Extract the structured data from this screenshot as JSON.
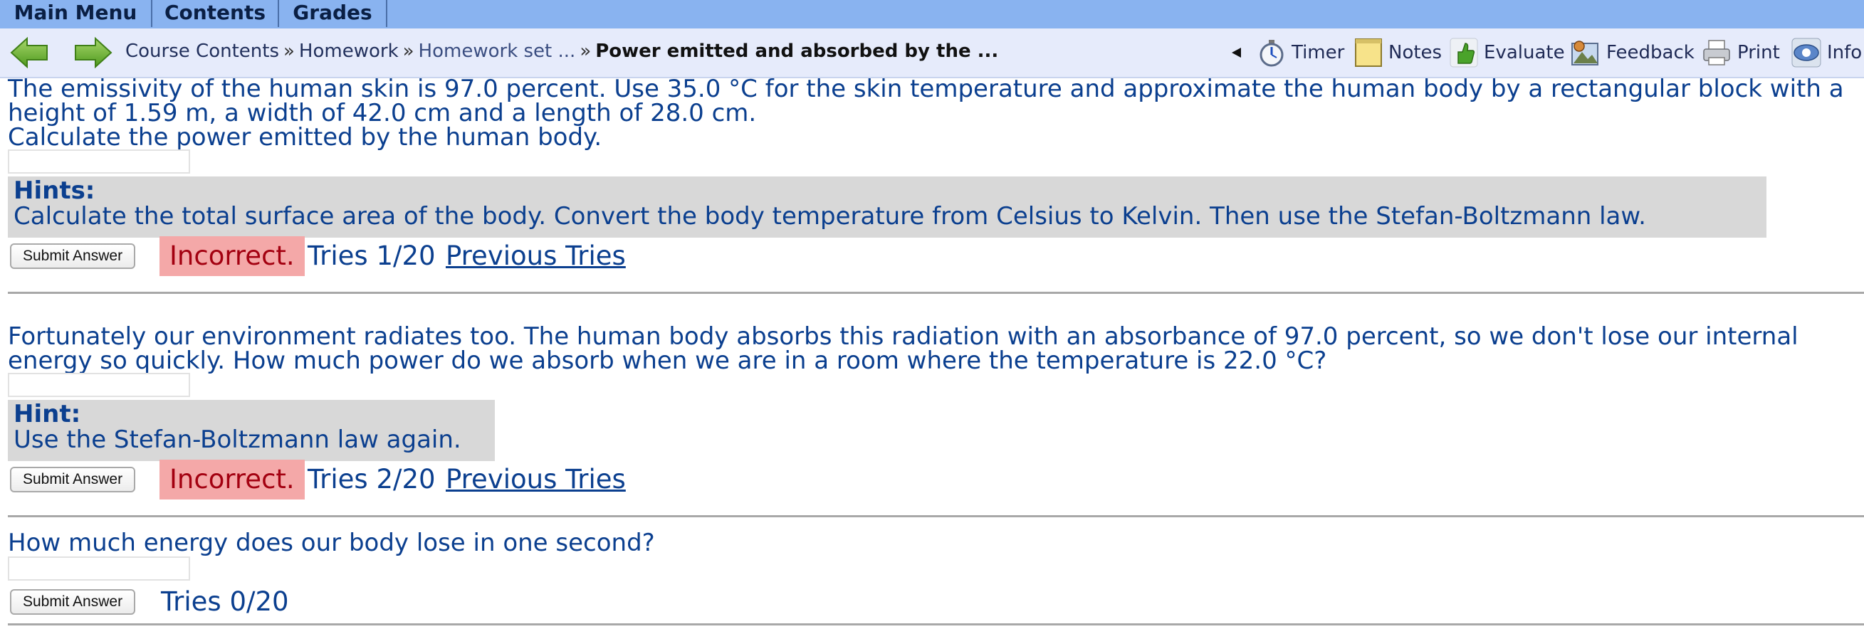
{
  "menu": {
    "tabs": [
      "Main Menu",
      "Contents",
      "Grades"
    ]
  },
  "nav": {
    "breadcrumb": {
      "course_contents": "Course Contents",
      "homework": "Homework",
      "homework_set": "Homework set ...",
      "current": "Power emitted and absorbed by the ...",
      "separator": "»"
    },
    "tools": {
      "timer": "Timer",
      "notes": "Notes",
      "evaluate": "Evaluate",
      "feedback": "Feedback",
      "print": "Print",
      "info": "Info"
    }
  },
  "parts": [
    {
      "question": "The emissivity of the human skin is 97.0 percent. Use 35.0 °C for the skin temperature and approximate the human body by a rectangular block with a height of 1.59 m, a width of 42.0 cm and a length of 28.0 cm.",
      "question2": "Calculate the power emitted by the human body.",
      "answer_value": "",
      "hint_title": "Hints:",
      "hint_text": "Calculate the total surface area of the body. Convert the body temperature from Celsius to Kelvin. Then use the Stefan-Boltzmann law.",
      "submit_label": "Submit Answer",
      "status": "Incorrect.",
      "tries": "Tries 1/20",
      "previous_tries": "Previous Tries"
    },
    {
      "question": "Fortunately our environment radiates too. The human body absorbs this radiation with an absorbance of 97.0 percent, so we don't lose our internal energy so quickly. How much power do we absorb when we are in a room where the temperature is 22.0 °C?",
      "answer_value": "",
      "hint_title": "Hint:",
      "hint_text": "Use the Stefan-Boltzmann law again.",
      "submit_label": "Submit Answer",
      "status": "Incorrect.",
      "tries": "Tries 2/20",
      "previous_tries": "Previous Tries"
    },
    {
      "question": "How much energy does our body lose in one second?",
      "answer_value": "",
      "submit_label": "Submit Answer",
      "tries": "Tries 0/20"
    }
  ],
  "colors": {
    "topbar": "#89b3f0",
    "navbar": "#e6ebfb",
    "question_text": "#0b3f8f",
    "incorrect_bg": "#f4a8a8",
    "incorrect_text": "#a30010",
    "hint_bg": "#d8d8d8"
  }
}
